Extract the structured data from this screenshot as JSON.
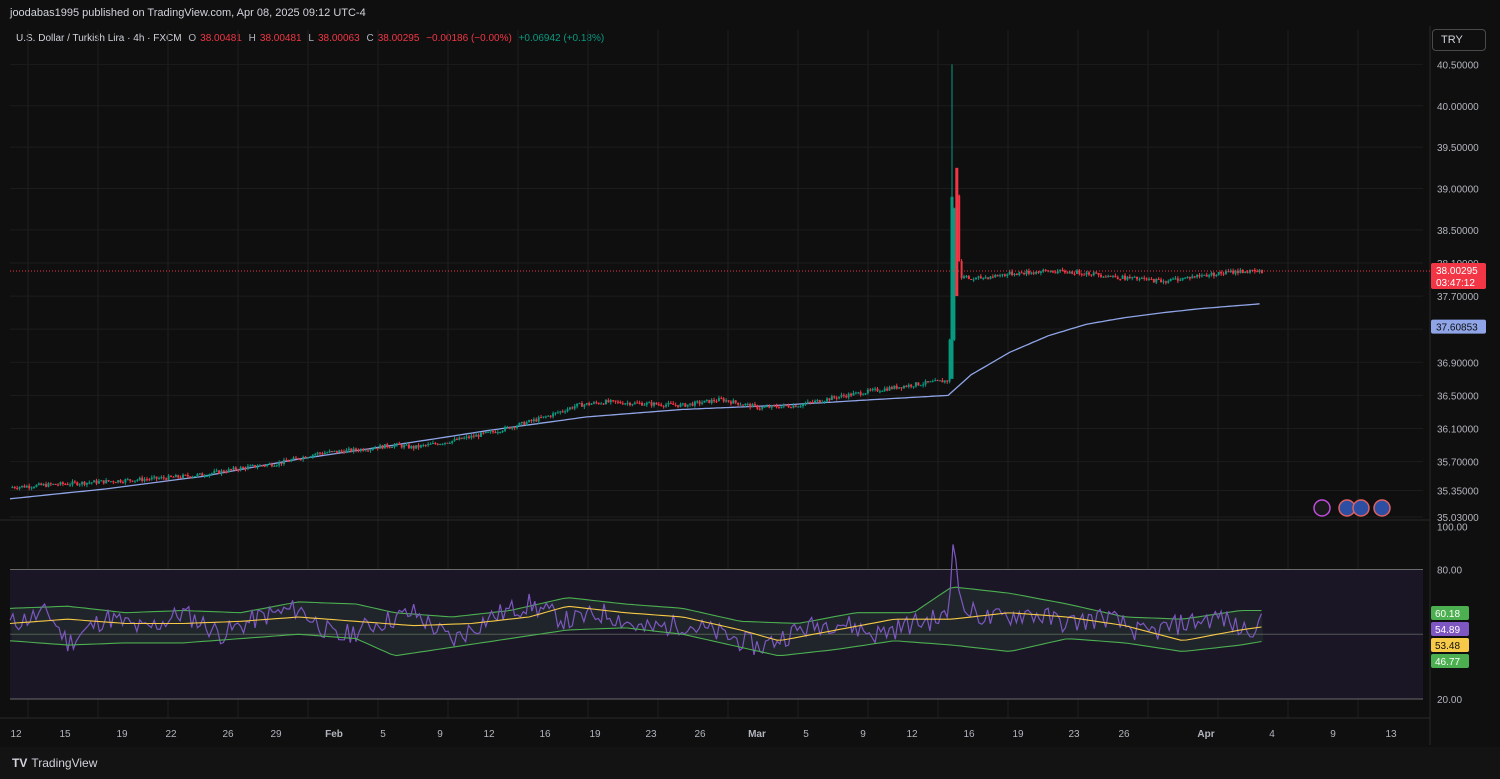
{
  "header": {
    "publisher": "joodabas1995 published on TradingView.com, Apr 08, 2025 09:12 UTC-4",
    "symbol": "U.S. Dollar / Turkish Lira · 4h · FXCM",
    "o_label": "O",
    "o_value": "38.00481",
    "h_label": "H",
    "h_value": "38.00481",
    "l_label": "L",
    "l_value": "38.00063",
    "c_label": "C",
    "c_value": "38.00295",
    "change": "−0.00186 (−0.00%)",
    "change2": "+0.06942 (+0.18%)",
    "currency_button": "TRY"
  },
  "footer": {
    "logo_mark": "TV",
    "brand": "TradingView"
  },
  "colors": {
    "up": "#089981",
    "down": "#f23645",
    "ma": "#8fa5e8",
    "rsi": "#7e57c2",
    "rsi_ma": "#f7c948",
    "band": "#4caf50"
  },
  "chart_data": [
    {
      "type": "candlestick",
      "title": "U.S. Dollar / Turkish Lira",
      "timeframe": "4h",
      "ylim": [
        35.03,
        40.65
      ],
      "y_ticks": [
        "40.50000",
        "40.00000",
        "39.50000",
        "39.00000",
        "38.50000",
        "38.10000",
        "37.70000",
        "37.30000",
        "36.90000",
        "36.50000",
        "36.10000",
        "35.70000",
        "35.35000",
        "35.03000"
      ],
      "x_ticks": [
        "12",
        "15",
        "19",
        "22",
        "26",
        "29",
        "Feb",
        "5",
        "9",
        "12",
        "16",
        "19",
        "23",
        "26",
        "Mar",
        "5",
        "9",
        "12",
        "16",
        "19",
        "23",
        "26",
        "Apr",
        "4",
        "9",
        "13"
      ],
      "last_price": "38.00295",
      "countdown": "03:47:12",
      "ma_value": "37.60853",
      "price_path": [
        [
          0,
          35.39
        ],
        [
          5,
          35.46
        ],
        [
          8,
          35.5
        ],
        [
          10,
          35.54
        ],
        [
          12,
          35.62
        ],
        [
          14,
          35.68
        ],
        [
          16,
          35.8
        ],
        [
          18,
          35.84
        ],
        [
          20,
          35.9
        ],
        [
          21,
          35.87
        ],
        [
          23,
          35.95
        ],
        [
          25,
          36.05
        ],
        [
          27,
          36.18
        ],
        [
          28,
          36.25
        ],
        [
          29.5,
          36.38
        ],
        [
          31,
          36.42
        ],
        [
          33,
          36.4
        ],
        [
          35,
          36.38
        ],
        [
          37,
          36.45
        ],
        [
          39,
          36.35
        ],
        [
          41,
          36.38
        ],
        [
          43,
          36.48
        ],
        [
          45,
          36.56
        ],
        [
          47,
          36.63
        ],
        [
          48.8,
          36.68
        ],
        [
          49.2,
          39.25
        ],
        [
          49.4,
          37.95
        ],
        [
          50,
          37.9
        ],
        [
          52,
          37.97
        ],
        [
          54,
          38.0
        ],
        [
          56,
          37.98
        ],
        [
          58,
          37.92
        ],
        [
          60,
          37.88
        ],
        [
          62,
          37.95
        ],
        [
          64,
          38.0
        ],
        [
          65.2,
          37.99
        ]
      ],
      "ma_path": [
        [
          0,
          35.25
        ],
        [
          5,
          35.37
        ],
        [
          10,
          35.52
        ],
        [
          15,
          35.73
        ],
        [
          20,
          35.9
        ],
        [
          25,
          36.08
        ],
        [
          30,
          36.24
        ],
        [
          35,
          36.33
        ],
        [
          40,
          36.38
        ],
        [
          45,
          36.45
        ],
        [
          48.8,
          36.5
        ],
        [
          50,
          36.75
        ],
        [
          52,
          37.02
        ],
        [
          54,
          37.22
        ],
        [
          56,
          37.36
        ],
        [
          58,
          37.44
        ],
        [
          60,
          37.5
        ],
        [
          62,
          37.55
        ],
        [
          65.2,
          37.61
        ]
      ],
      "spike": {
        "x": 49.0,
        "low": 36.7,
        "high": 40.5
      }
    },
    {
      "type": "line",
      "title": "RSI",
      "ylim": [
        14,
        102
      ],
      "y_ticks": [
        "100.00",
        "80.00",
        "20.00"
      ],
      "levels": [
        80,
        50,
        20
      ],
      "series": [
        {
          "label": "60.18",
          "value": 60.18,
          "path": [
            [
              0,
              62
            ],
            [
              3,
              63
            ],
            [
              6,
              60
            ],
            [
              9,
              61
            ],
            [
              12,
              60
            ],
            [
              15,
              65
            ],
            [
              18,
              64
            ],
            [
              20,
              60
            ],
            [
              23,
              58
            ],
            [
              26,
              61
            ],
            [
              29,
              67
            ],
            [
              32,
              64
            ],
            [
              35,
              62
            ],
            [
              38,
              56
            ],
            [
              41,
              55
            ],
            [
              44,
              60
            ],
            [
              47,
              60
            ],
            [
              49,
              72
            ],
            [
              52,
              69
            ],
            [
              55,
              64
            ],
            [
              58,
              58
            ],
            [
              61,
              57
            ],
            [
              64,
              61
            ],
            [
              65.2,
              61
            ]
          ]
        },
        {
          "label": "54.89",
          "value": 54.89,
          "path": [
            [
              0,
              55
            ],
            [
              2,
              60
            ],
            [
              3,
              46
            ],
            [
              5,
              58
            ],
            [
              7,
              52
            ],
            [
              9,
              60
            ],
            [
              11,
              50
            ],
            [
              13,
              58
            ],
            [
              15,
              62
            ],
            [
              17,
              48
            ],
            [
              19,
              55
            ],
            [
              21,
              60
            ],
            [
              23,
              47
            ],
            [
              25,
              58
            ],
            [
              27,
              64
            ],
            [
              29,
              56
            ],
            [
              31,
              60
            ],
            [
              33,
              52
            ],
            [
              35,
              55
            ],
            [
              37,
              50
            ],
            [
              39,
              44
            ],
            [
              41,
              52
            ],
            [
              43,
              56
            ],
            [
              45,
              50
            ],
            [
              47,
              55
            ],
            [
              48.8,
              58
            ],
            [
              49.1,
              98
            ],
            [
              49.5,
              62
            ],
            [
              51,
              57
            ],
            [
              53,
              60
            ],
            [
              55,
              55
            ],
            [
              57,
              58
            ],
            [
              59,
              50
            ],
            [
              61,
              55
            ],
            [
              63,
              58
            ],
            [
              64,
              52
            ],
            [
              65.2,
              55
            ]
          ]
        },
        {
          "label": "53.48",
          "value": 53.48,
          "path": [
            [
              0,
              55
            ],
            [
              3,
              57
            ],
            [
              6,
              55
            ],
            [
              9,
              55
            ],
            [
              12,
              56
            ],
            [
              15,
              58
            ],
            [
              18,
              56
            ],
            [
              21,
              54
            ],
            [
              24,
              55
            ],
            [
              27,
              58
            ],
            [
              29,
              63
            ],
            [
              32,
              60
            ],
            [
              35,
              58
            ],
            [
              38,
              52
            ],
            [
              40,
              47
            ],
            [
              43,
              52
            ],
            [
              46,
              57
            ],
            [
              49,
              57
            ],
            [
              52,
              60
            ],
            [
              55,
              58
            ],
            [
              58,
              54
            ],
            [
              61,
              47
            ],
            [
              64,
              52
            ],
            [
              65.2,
              53.5
            ]
          ]
        },
        {
          "label": "46.77",
          "value": 46.77,
          "path": [
            [
              0,
              47
            ],
            [
              3,
              45
            ],
            [
              6,
              46
            ],
            [
              9,
              46
            ],
            [
              12,
              48
            ],
            [
              15,
              50
            ],
            [
              18,
              48
            ],
            [
              20,
              40
            ],
            [
              23,
              44
            ],
            [
              26,
              48
            ],
            [
              29,
              52
            ],
            [
              32,
              53
            ],
            [
              35,
              50
            ],
            [
              38,
              44
            ],
            [
              40,
              40
            ],
            [
              43,
              43
            ],
            [
              46,
              47
            ],
            [
              49,
              45
            ],
            [
              52,
              42
            ],
            [
              55,
              48
            ],
            [
              58,
              46
            ],
            [
              61,
              42
            ],
            [
              64,
              45
            ],
            [
              65.2,
              46.8
            ]
          ]
        }
      ]
    }
  ]
}
